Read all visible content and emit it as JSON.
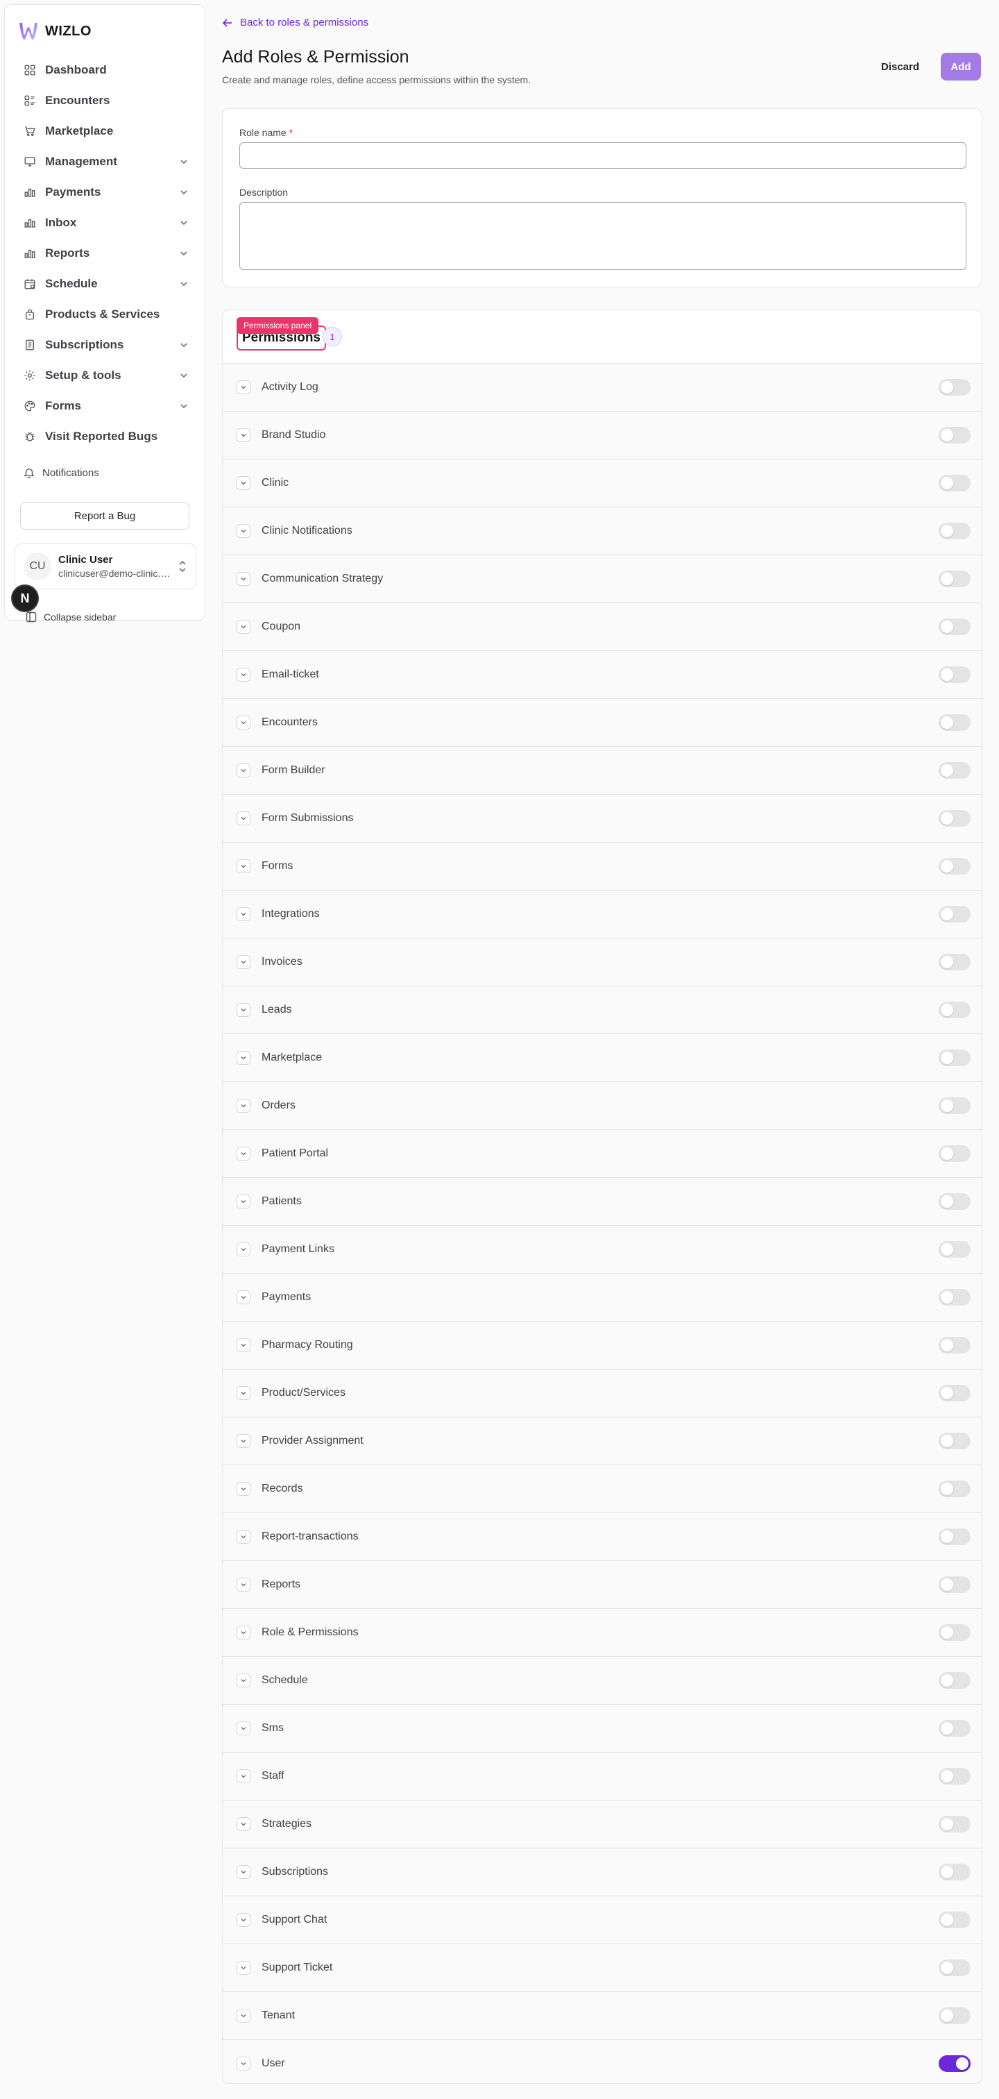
{
  "brand": {
    "name": "WIZLO",
    "accent": "#6d28d9",
    "add_button_color": "#a47be6",
    "highlight": "#e8366b"
  },
  "sidebar": {
    "items": [
      {
        "label": "Dashboard",
        "icon": "dashboard-icon",
        "has_chevron": false
      },
      {
        "label": "Encounters",
        "icon": "encounters-icon",
        "has_chevron": false
      },
      {
        "label": "Marketplace",
        "icon": "cart-icon",
        "has_chevron": false
      },
      {
        "label": "Management",
        "icon": "monitor-icon",
        "has_chevron": true
      },
      {
        "label": "Payments",
        "icon": "bar-chart-icon",
        "has_chevron": true
      },
      {
        "label": "Inbox",
        "icon": "bar-chart-icon",
        "has_chevron": true
      },
      {
        "label": "Reports",
        "icon": "bar-chart-icon",
        "has_chevron": true
      },
      {
        "label": "Schedule",
        "icon": "calendar-icon",
        "has_chevron": true
      },
      {
        "label": "Products & Services",
        "icon": "bag-icon",
        "has_chevron": false
      },
      {
        "label": "Subscriptions",
        "icon": "document-icon",
        "has_chevron": true
      },
      {
        "label": "Setup & tools",
        "icon": "gear-icon",
        "has_chevron": true
      },
      {
        "label": "Forms",
        "icon": "palette-icon",
        "has_chevron": true
      },
      {
        "label": "Visit Reported Bugs",
        "icon": "bug-icon",
        "has_chevron": false
      }
    ],
    "notifications_label": "Notifications",
    "report_bug_label": "Report a Bug",
    "user": {
      "initials": "CU",
      "name": "Clinic User",
      "email": "clinicuser@demo-clinic.com"
    },
    "badge_letter": "N",
    "collapse_label": "Collapse sidebar"
  },
  "header": {
    "back_label": "Back to roles & permissions",
    "title": "Add Roles & Permission",
    "subtitle": "Create and manage roles, define access permissions within the system.",
    "discard_label": "Discard",
    "add_label": "Add"
  },
  "form": {
    "role_name_label": "Role name",
    "required_mark": "*",
    "role_name_value": "",
    "description_label": "Description",
    "description_value": ""
  },
  "permissions": {
    "tag_label": "Permissions panel",
    "title": "Permissions",
    "count": "1",
    "items": [
      {
        "label": "Activity Log",
        "enabled": false
      },
      {
        "label": "Brand Studio",
        "enabled": false
      },
      {
        "label": "Clinic",
        "enabled": false
      },
      {
        "label": "Clinic Notifications",
        "enabled": false
      },
      {
        "label": "Communication Strategy",
        "enabled": false
      },
      {
        "label": "Coupon",
        "enabled": false
      },
      {
        "label": "Email-ticket",
        "enabled": false
      },
      {
        "label": "Encounters",
        "enabled": false
      },
      {
        "label": "Form Builder",
        "enabled": false
      },
      {
        "label": "Form Submissions",
        "enabled": false
      },
      {
        "label": "Forms",
        "enabled": false
      },
      {
        "label": "Integrations",
        "enabled": false
      },
      {
        "label": "Invoices",
        "enabled": false
      },
      {
        "label": "Leads",
        "enabled": false
      },
      {
        "label": "Marketplace",
        "enabled": false
      },
      {
        "label": "Orders",
        "enabled": false
      },
      {
        "label": "Patient Portal",
        "enabled": false
      },
      {
        "label": "Patients",
        "enabled": false
      },
      {
        "label": "Payment Links",
        "enabled": false
      },
      {
        "label": "Payments",
        "enabled": false
      },
      {
        "label": "Pharmacy Routing",
        "enabled": false
      },
      {
        "label": "Product/Services",
        "enabled": false
      },
      {
        "label": "Provider Assignment",
        "enabled": false
      },
      {
        "label": "Records",
        "enabled": false
      },
      {
        "label": "Report-transactions",
        "enabled": false
      },
      {
        "label": "Reports",
        "enabled": false
      },
      {
        "label": "Role & Permissions",
        "enabled": false
      },
      {
        "label": "Schedule",
        "enabled": false
      },
      {
        "label": "Sms",
        "enabled": false
      },
      {
        "label": "Staff",
        "enabled": false
      },
      {
        "label": "Strategies",
        "enabled": false
      },
      {
        "label": "Subscriptions",
        "enabled": false
      },
      {
        "label": "Support Chat",
        "enabled": false
      },
      {
        "label": "Support Ticket",
        "enabled": false
      },
      {
        "label": "Tenant",
        "enabled": false
      },
      {
        "label": "User",
        "enabled": true
      }
    ]
  }
}
